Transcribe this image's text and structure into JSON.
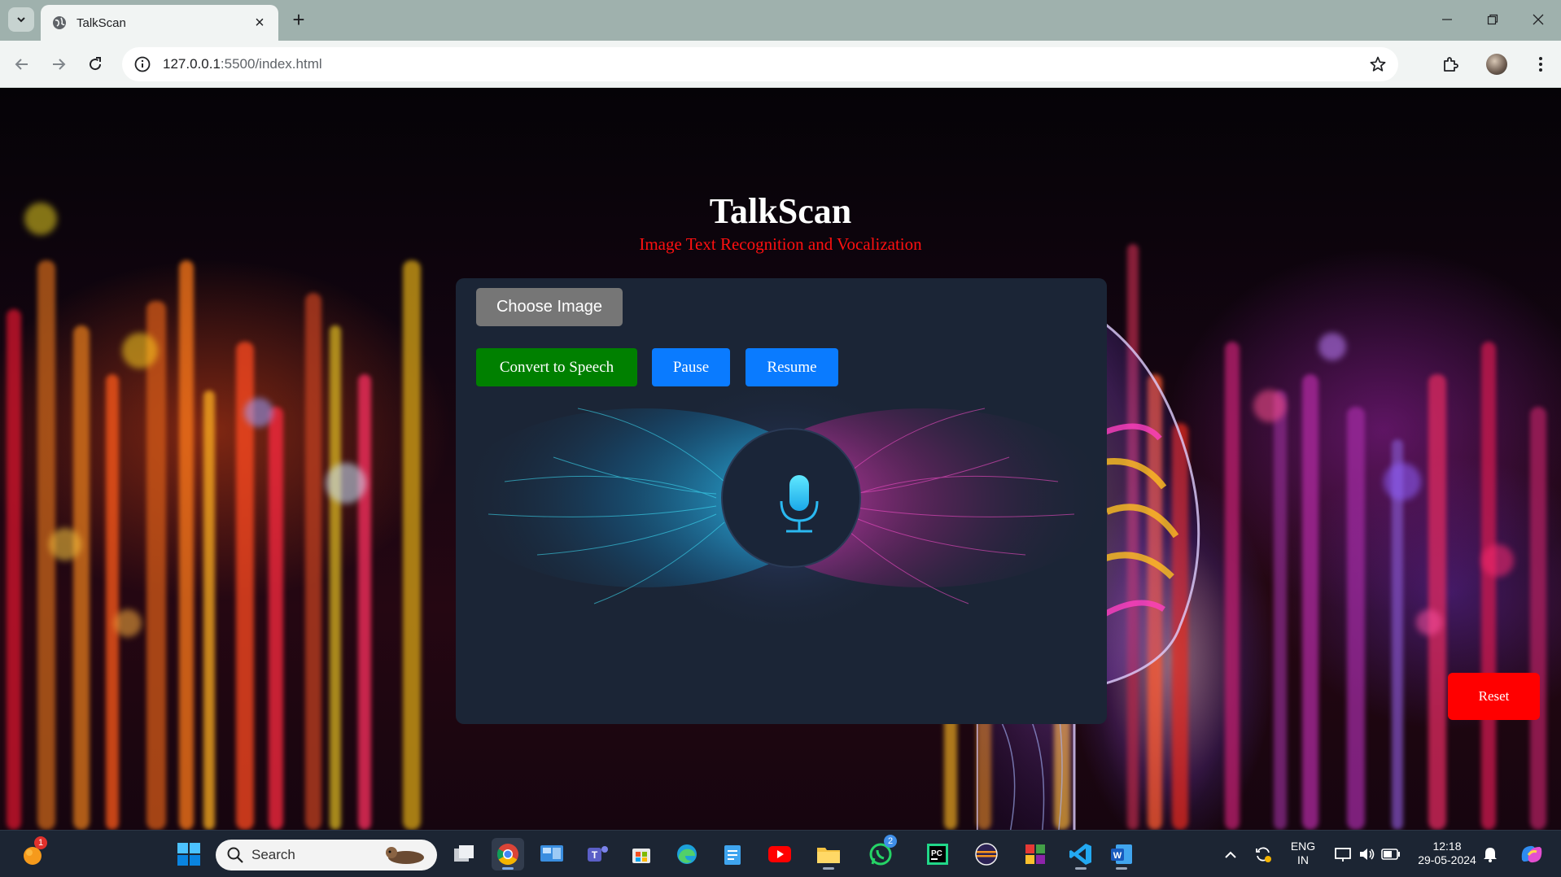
{
  "browser": {
    "tab_title": "TalkScan",
    "url_host": "127.0.0.1",
    "url_rest": ":5500/index.html"
  },
  "page": {
    "title": "TalkScan",
    "subtitle": "Image Text Recognition and Vocalization",
    "buttons": {
      "choose_image": "Choose Image",
      "convert": "Convert to Speech",
      "pause": "Pause",
      "resume": "Resume",
      "reset": "Reset"
    },
    "colors": {
      "card_bg": "#1b2536",
      "convert": "#008000",
      "pause_resume": "#0a7bff",
      "reset": "#ff0000",
      "subtitle": "#ff1010"
    }
  },
  "taskbar": {
    "search_placeholder": "Search",
    "language_line1": "ENG",
    "language_line2": "IN",
    "time": "12:18",
    "date": "29-05-2024",
    "badges": {
      "start_app": "1",
      "whatsapp": "2"
    }
  }
}
